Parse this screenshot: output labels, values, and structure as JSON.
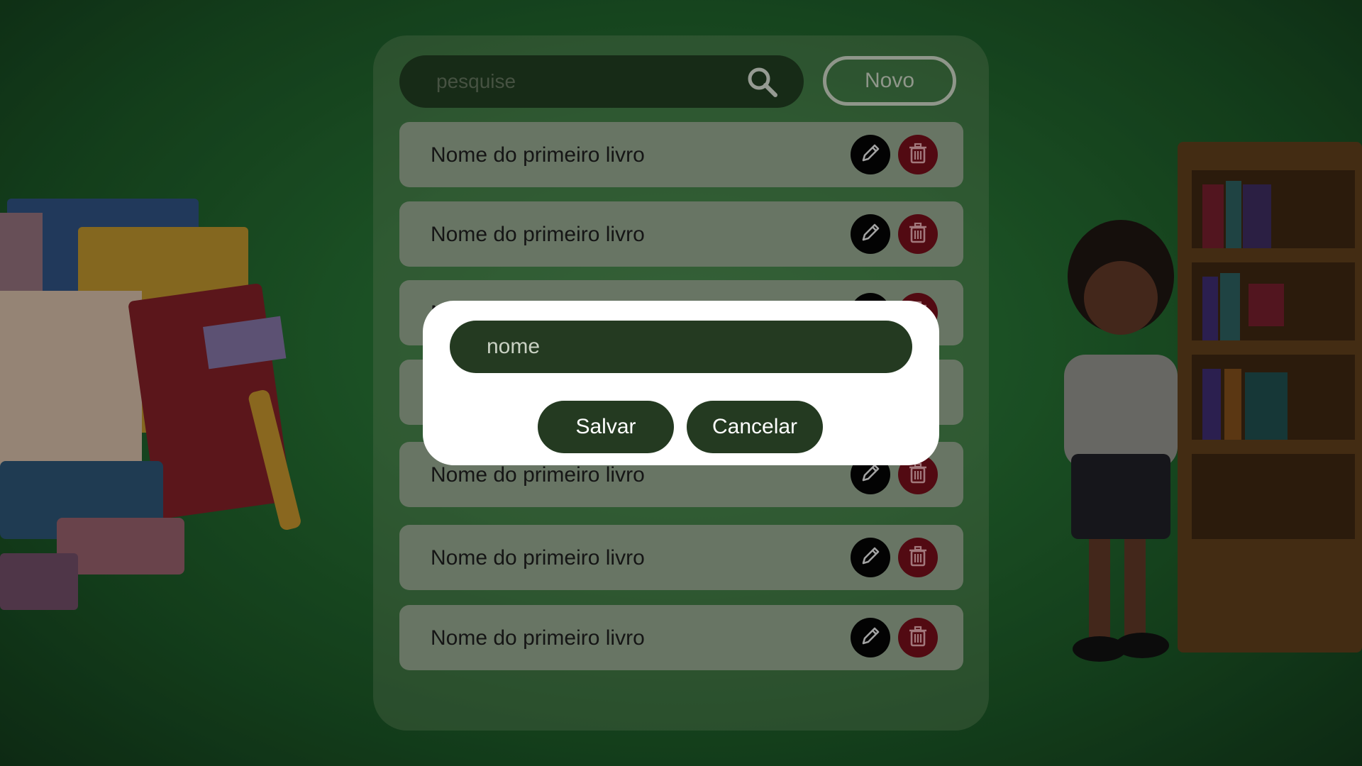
{
  "search": {
    "placeholder": "pesquise",
    "icon": "search-icon"
  },
  "toolbar": {
    "new_label": "Novo"
  },
  "books": [
    {
      "title": "Nome do primeiro livro"
    },
    {
      "title": "Nome do primeiro livro"
    },
    {
      "title": "Nome do primeiro livro"
    },
    {
      "title": "Nome do primeiro livro"
    },
    {
      "title": "Nome do primeiro livro"
    },
    {
      "title": "Nome do primeiro livro"
    },
    {
      "title": "Nome do primeiro livro"
    }
  ],
  "row_actions": {
    "edit_icon": "pencil-icon",
    "delete_icon": "trash-icon"
  },
  "modal": {
    "name_placeholder": "nome",
    "save_label": "Salvar",
    "cancel_label": "Cancelar"
  },
  "colors": {
    "background": "#246a30",
    "dark_green": "#243a21",
    "delete_red": "#c8283c",
    "modal_bg": "#ffffff"
  }
}
